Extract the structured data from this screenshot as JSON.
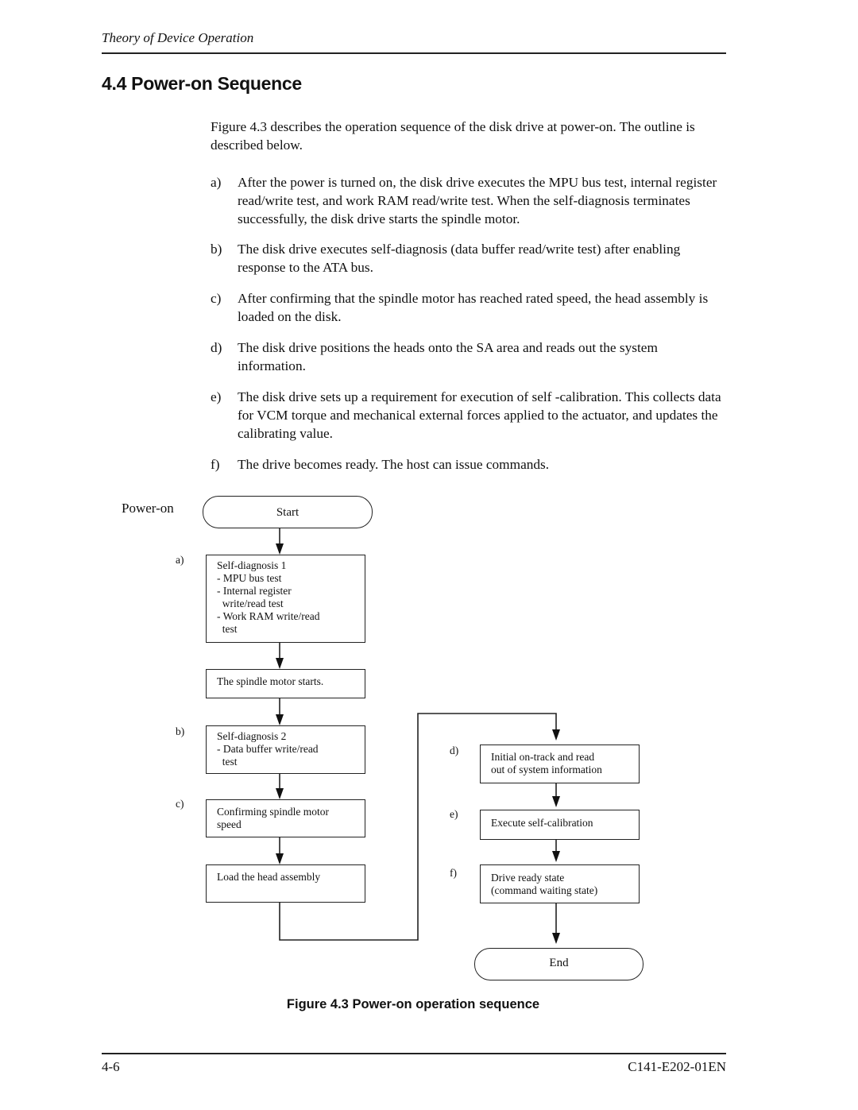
{
  "header": {
    "running_head": "Theory of Device Operation"
  },
  "section": {
    "title": "4.4  Power-on Sequence"
  },
  "intro": "Figure 4.3 describes the operation sequence of the disk drive at power-on.  The outline is described below.",
  "steps": [
    {
      "letter": "a)",
      "text": "After the power is turned on, the disk drive executes the MPU bus test, internal register read/write test, and work RAM read/write test.  When the self-diagnosis terminates successfully, the disk drive starts the spindle motor."
    },
    {
      "letter": "b)",
      "text": "The disk drive executes self-diagnosis (data buffer read/write test) after enabling response to the ATA bus."
    },
    {
      "letter": "c)",
      "text": "After confirming that the spindle motor has reached rated speed, the head assembly is loaded on the disk."
    },
    {
      "letter": "d)",
      "text": "The disk drive positions the heads onto the SA area and reads out the system information."
    },
    {
      "letter": "e)",
      "text": "The disk drive sets up a requirement for execution of self -calibration.  This collects data for VCM torque and mechanical external forces applied to the actuator, and updates the calibrating value."
    },
    {
      "letter": "f)",
      "text": "The drive becomes ready.  The host can issue commands."
    }
  ],
  "flowchart": {
    "power_on_label": "Power-on",
    "start": "Start",
    "end": "End",
    "nodes": [
      {
        "step": "a)",
        "lines": [
          "Self-diagnosis 1",
          "- MPU bus test",
          "- Internal register",
          "  write/read test",
          "- Work RAM write/read",
          "  test"
        ]
      },
      {
        "step": "",
        "lines": [
          "The spindle motor starts."
        ]
      },
      {
        "step": "b)",
        "lines": [
          "Self-diagnosis 2",
          "- Data buffer write/read",
          "  test"
        ]
      },
      {
        "step": "c)",
        "lines": [
          "Confirming spindle motor",
          "speed"
        ]
      },
      {
        "step": "",
        "lines": [
          "Load the head assembly"
        ]
      },
      {
        "step": "d)",
        "lines": [
          "Initial on-track and read",
          "out of system information"
        ]
      },
      {
        "step": "e)",
        "lines": [
          "Execute self-calibration"
        ]
      },
      {
        "step": "f)",
        "lines": [
          "Drive ready state",
          "(command waiting state)"
        ]
      }
    ]
  },
  "figure_caption": "Figure 4.3  Power-on operation sequence",
  "footer": {
    "page_number": "4-6",
    "document_id": "C141-E202-01EN"
  }
}
